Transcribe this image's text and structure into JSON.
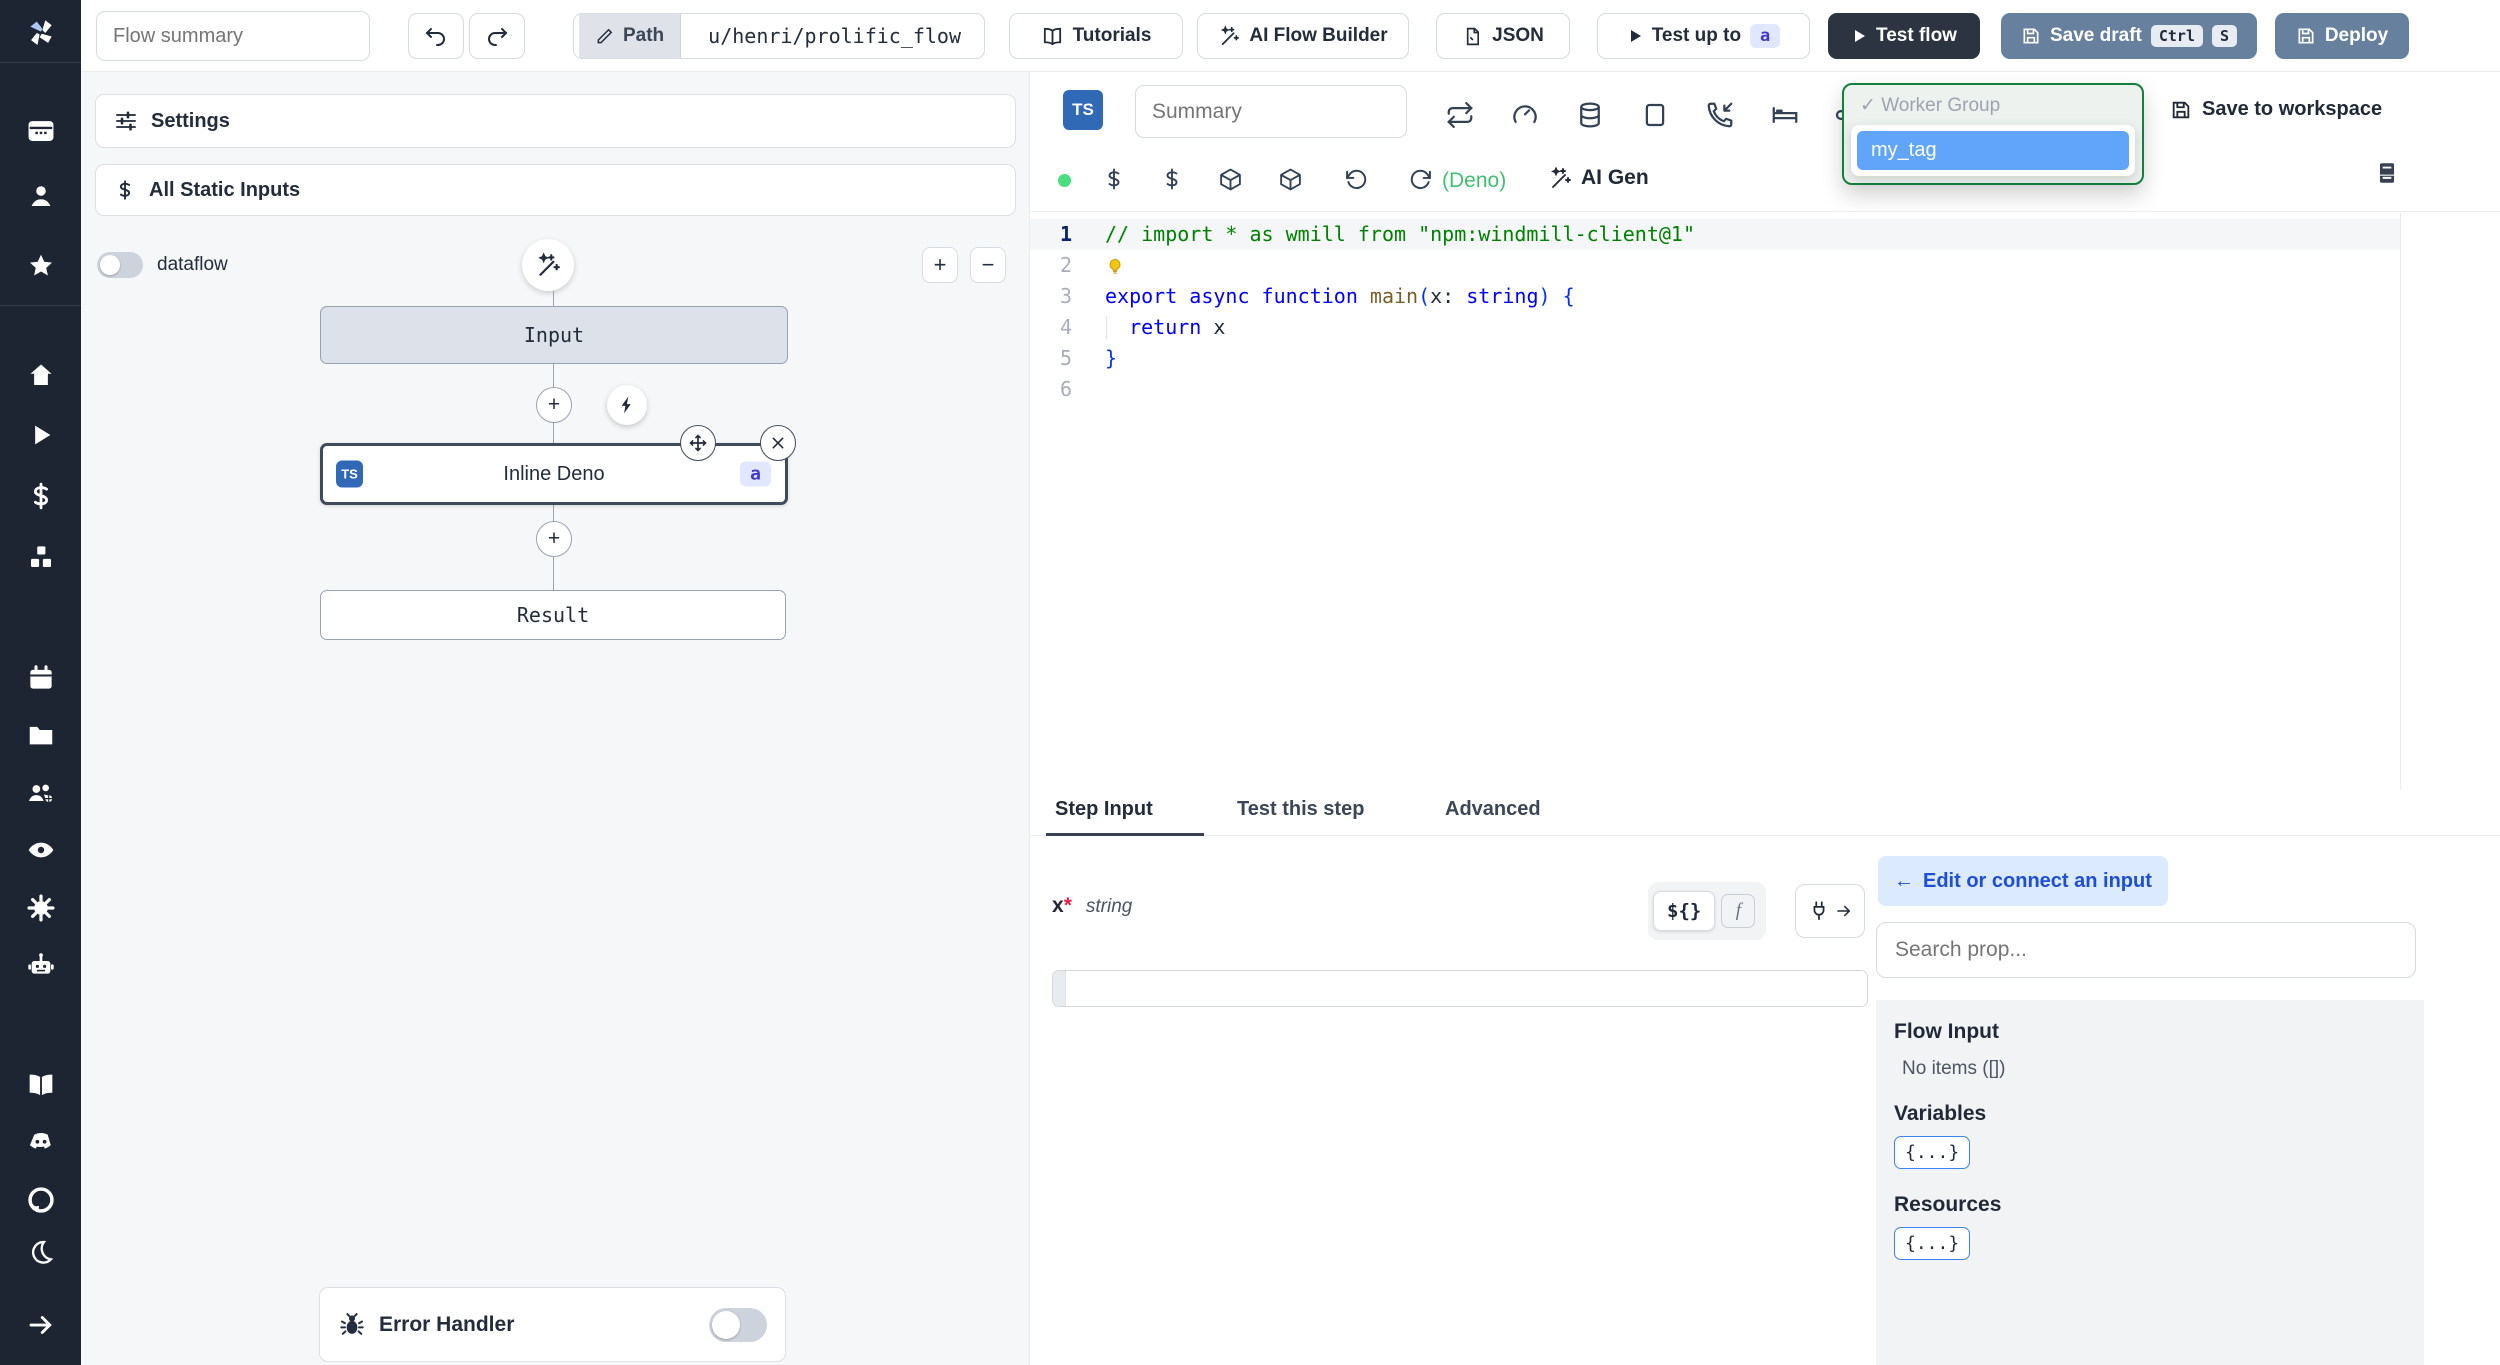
{
  "colors": {
    "sidebar_bg": "#1e2532",
    "dark_button": "#2b3440",
    "slate_button": "#66809e",
    "dropdown_border": "#15803d",
    "tag_selected_bg": "#60a5fa",
    "ts_badge": "#3069b5",
    "badge_bg": "#e0e7ff",
    "badge_text": "#4338ca",
    "link_blue": "#1d4ed8",
    "pill_blue_bg": "#dbeafe",
    "green_dot": "#4ade80",
    "deno_green": "#3fbf6f"
  },
  "sidebar": {
    "icons": [
      "windmill-logo",
      "apps",
      "users",
      "favorites",
      "home",
      "runs",
      "variables",
      "resources",
      "schedules",
      "folders",
      "groups",
      "audit-logs",
      "settings",
      "workers",
      "docs",
      "discord",
      "github",
      "dark-mode",
      "expand"
    ]
  },
  "topbar": {
    "flow_summary_placeholder": "Flow summary",
    "path_label": "Path",
    "path_value": "u/henri/prolific_flow",
    "tutorials_label": "Tutorials",
    "ai_flow_builder_label": "AI Flow Builder",
    "json_label": "JSON",
    "test_up_to_label": "Test up to",
    "test_up_to_badge": "a",
    "test_flow_label": "Test flow",
    "save_draft_label": "Save draft",
    "save_draft_keys": [
      "Ctrl",
      "S"
    ],
    "deploy_label": "Deploy"
  },
  "flow_panel": {
    "settings_label": "Settings",
    "static_inputs_label": "All Static Inputs",
    "dataflow_label": "dataflow",
    "zoom_in": "+",
    "zoom_out": "−",
    "nodes": {
      "input_label": "Input",
      "step_label": "Inline Deno",
      "step_lang_badge": "TS",
      "step_id_badge": "a",
      "result_label": "Result"
    },
    "error_handler_label": "Error Handler"
  },
  "editor": {
    "lang_badge": "TS",
    "summary_placeholder": "Summary",
    "language_label": "(Deno)",
    "ai_gen_label": "AI Gen",
    "save_to_workspace_label": "Save to workspace",
    "worker_group": {
      "check": "✓",
      "selected_label": "Worker Group",
      "options": [
        "my_tag"
      ]
    }
  },
  "code": {
    "active_line": 1,
    "line_numbers": [
      "1",
      "2",
      "3",
      "4",
      "5",
      "6"
    ],
    "lines": [
      {
        "tokens": [
          {
            "text": "// import * as wmill from \"npm:windmill-client@1\"",
            "cls": "tok-comment"
          }
        ]
      },
      {
        "bulb": true,
        "tokens": []
      },
      {
        "tokens": [
          {
            "text": "export async function ",
            "cls": "tok-kw"
          },
          {
            "text": "main",
            "cls": "tok-fn"
          },
          {
            "text": "(",
            "cls": "tok-paren"
          },
          {
            "text": "x",
            "cls": "tok-plain"
          },
          {
            "text": ": ",
            "cls": "tok-plain"
          },
          {
            "text": "string",
            "cls": "tok-kw"
          },
          {
            "text": ")",
            "cls": "tok-paren"
          },
          {
            "text": " {",
            "cls": "tok-paren"
          }
        ]
      },
      {
        "indent_guide": true,
        "tokens": [
          {
            "text": "  ",
            "cls": "tok-plain"
          },
          {
            "text": "return",
            "cls": "tok-kw"
          },
          {
            "text": " x",
            "cls": "tok-plain"
          }
        ]
      },
      {
        "tokens": [
          {
            "text": "}",
            "cls": "tok-paren"
          }
        ]
      },
      {
        "tokens": []
      }
    ]
  },
  "step_panel": {
    "tabs": [
      "Step Input",
      "Test this step",
      "Advanced"
    ],
    "active_tab": "Step Input",
    "field": {
      "name": "x",
      "required_mark": "*",
      "type": "string"
    },
    "expr_button_label": "${}",
    "fn_button_label": "f",
    "prop_picker": {
      "back_arrow": "←",
      "back_label": "Edit or connect an input",
      "search_placeholder": "Search prop...",
      "flow_input_title": "Flow Input",
      "flow_input_empty": "No items ([])",
      "variables_title": "Variables",
      "variables_chip": "{...}",
      "resources_title": "Resources",
      "resources_chip": "{...}"
    }
  }
}
